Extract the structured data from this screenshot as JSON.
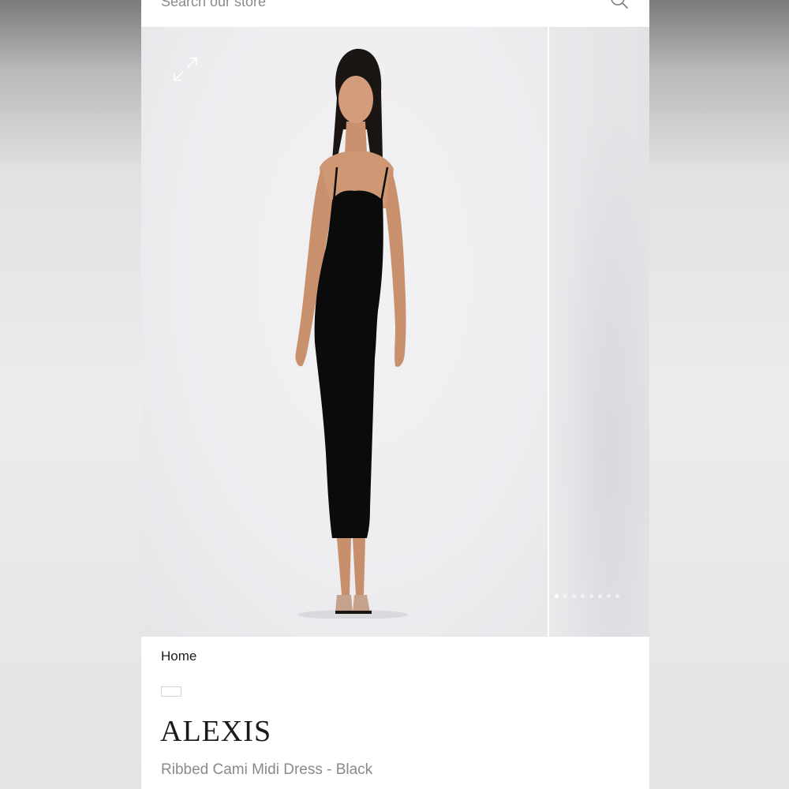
{
  "search": {
    "placeholder": "Search our store"
  },
  "gallery": {
    "slide_count": 8,
    "active_slide": 1
  },
  "breadcrumb": {
    "home_label": "Home"
  },
  "product": {
    "brand": "ALEXIS",
    "name": "Ribbed Cami Midi Dress - Black",
    "dress_color": "#0b0b0c"
  },
  "icons": {
    "search": "search-icon",
    "expand": "expand-icon"
  }
}
